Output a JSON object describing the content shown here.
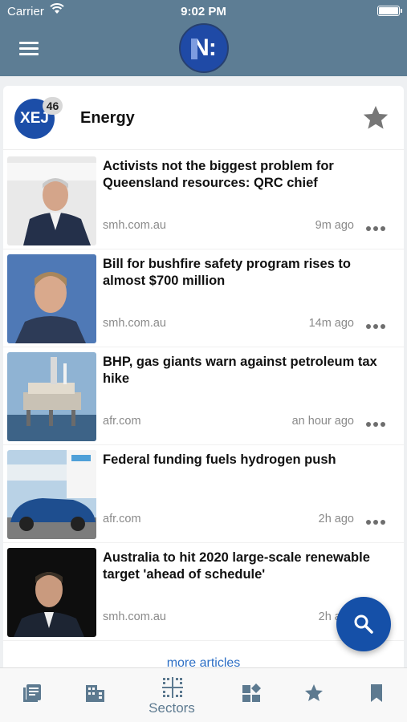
{
  "status_bar": {
    "carrier": "Carrier",
    "time": "9:02 PM"
  },
  "sector": {
    "code": "XEJ",
    "count": "46",
    "name": "Energy"
  },
  "articles": [
    {
      "headline": "Activists not the biggest problem for Queensland resources: QRC chief",
      "source": "smh.com.au",
      "age": "9m ago"
    },
    {
      "headline": "Bill for bushfire safety program rises to almost $700 million",
      "source": "smh.com.au",
      "age": "14m ago"
    },
    {
      "headline": "BHP, gas giants warn against petroleum tax hike",
      "source": "afr.com",
      "age": "an hour ago"
    },
    {
      "headline": "Federal funding fuels hydrogen push",
      "source": "afr.com",
      "age": "2h ago"
    },
    {
      "headline": "Australia to hit 2020 large-scale renewable target 'ahead of schedule'",
      "source": "smh.com.au",
      "age": "2h ago"
    }
  ],
  "more_articles": "more articles",
  "tabs": [
    {
      "icon": "news-icon"
    },
    {
      "icon": "building-icon"
    },
    {
      "icon": "sectors-icon",
      "label": "Sectors",
      "active": true
    },
    {
      "icon": "dashboard-icon"
    },
    {
      "icon": "star-icon"
    },
    {
      "icon": "bookmark-icon"
    }
  ],
  "colors": {
    "nav": "#5d7d94",
    "brand": "#1c4ea8",
    "fab": "#1550a8",
    "tab_icon": "#5d7a90",
    "link": "#2d6fc5"
  }
}
